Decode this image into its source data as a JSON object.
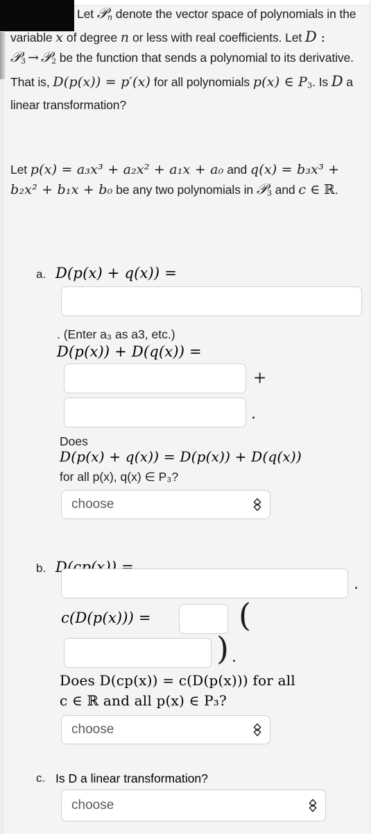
{
  "problem": {
    "intro_parts": {
      "s1": "Let ",
      "p_sym": "P",
      "p_sub": "n",
      "s2": " denote the vector space of polynomials in the variable ",
      "x1": "x",
      "s3": " of degree ",
      "n1": "n",
      "s4": " or less with real coefficients. Let ",
      "D1": "D",
      "colon": " : ",
      "P3a": "P",
      "sub3a": "3",
      "arrow": "→",
      "P2a": "P",
      "sub2a": "2",
      "s5": " be the function that sends a polynomial to its derivative. That is, ",
      "eq1": "D(p(x)) = p′(x)",
      "s6": " for all polynomials ",
      "eq2": "p(x) ∈ P",
      "sub3b": "3",
      "s7": ". Is ",
      "D2": "D",
      "s8": " a linear transformation?"
    },
    "setup_parts": {
      "s1": "Let ",
      "pdef": "p(x) = a₃x³ + a₂x² + a₁x + a₀",
      "s2": " and ",
      "qdef": "q(x) = b₃x³ + b₂x² + b₁x + b₀",
      "s3": " be any two polynomials in ",
      "P3": "P",
      "sub3": "3",
      "s4": " and ",
      "c": "c",
      "in": " ∈ ",
      "R": "ℝ",
      "s5": "."
    }
  },
  "parts": [
    {
      "label": "a.",
      "heading": "D(p(x) + q(x)) =",
      "hint": ". (Enter a₃ as a3, etc.)",
      "subheading": "D(p(x)) + D(q(x)) =",
      "field1_value": "",
      "field2_value": "",
      "field3_value": "",
      "plus_op": "+",
      "period_op": ".",
      "question_lead": "Does",
      "question_eq": "D(p(x) + q(x)) = D(p(x)) + D(q(x))",
      "question_tail": "for all p(x), q(x) ∈ P₃?",
      "select_value": "choose"
    },
    {
      "label": "b.",
      "heading": "D(cp(x)) =",
      "field1_value": "",
      "period_op": ".",
      "subheading": "c(D(p(x))) =",
      "field2_value": "",
      "field3_value": "",
      "open_paren": "(",
      "close_paren": ")",
      "period_op2": ".",
      "question_line1": "Does D(cp(x)) = c(D(p(x))) for all",
      "question_line2": "c ∈ ℝ and all p(x) ∈ P₃?",
      "select_value": "choose"
    },
    {
      "label": "c.",
      "heading": "Is D a linear transformation?",
      "select_value": "choose"
    }
  ],
  "colors": {
    "page_background": "#f4f4f4",
    "text": "#1c1c1c",
    "field_background": "#ffffff",
    "field_border": "#d2d2d2",
    "select_placeholder_text": "#5a5a5a",
    "redaction": "#090909"
  }
}
